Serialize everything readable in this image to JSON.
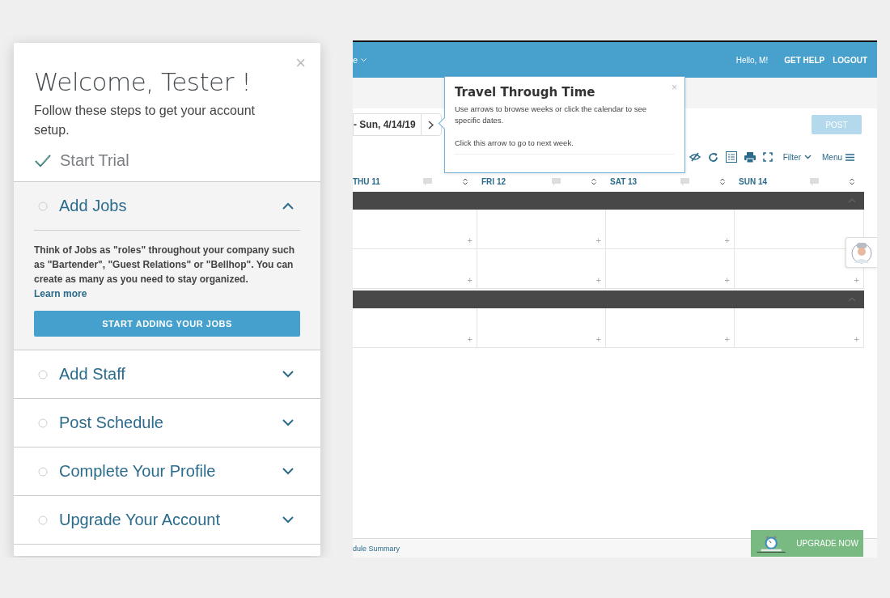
{
  "welcome_panel": {
    "close": "×",
    "title": "Welcome, Tester !",
    "subtitle": "Follow these steps to get your account setup.",
    "steps": [
      {
        "kind": "done",
        "label": "Start Trial"
      },
      {
        "kind": "step",
        "label": "Add Jobs",
        "expanded": true,
        "description": "Think of Jobs as \"roles\" throughout your company such as \"Bartender\", \"Guest Relations\" or \"Bellhop\". You can create as many as you need to stay organized.",
        "link": "Learn more",
        "button": "START ADDING YOUR JOBS"
      },
      {
        "kind": "step",
        "label": "Add Staff",
        "expanded": false
      },
      {
        "kind": "step",
        "label": "Post Schedule",
        "expanded": false
      },
      {
        "kind": "step",
        "label": "Complete Your Profile",
        "expanded": false
      },
      {
        "kind": "step",
        "label": "Upgrade Your Account",
        "expanded": false
      }
    ]
  },
  "schedule": {
    "header": {
      "menu_fragment": "e",
      "greeting": "Hello, M!",
      "links": [
        "GET HELP",
        "LOGOUT"
      ]
    },
    "date_range": "- Sun, 4/14/19",
    "post_button": {
      "label": "POST",
      "disabled": true
    },
    "toolbar": {
      "filter": "Filter",
      "menu": "Menu"
    },
    "days": [
      "THU 11",
      "FRI 12",
      "SAT 13",
      "SUN 14"
    ],
    "sections": [
      {
        "expanded": true,
        "rows": [
          [
            "+",
            "+",
            "+",
            null
          ],
          [
            "+",
            "+",
            "+",
            "+"
          ]
        ]
      },
      {
        "expanded": true,
        "rows": [
          [
            "+",
            "+",
            "+",
            "+"
          ]
        ]
      }
    ],
    "footer_link": "dule Summary",
    "upgrade_button": "UPGRADE NOW",
    "tooltip": {
      "title": "Travel Through Time",
      "close": "×",
      "lines": [
        "Use arrows to browse weeks or click the calendar to see specific dates.",
        "Click this arrow to go to next week."
      ]
    }
  }
}
